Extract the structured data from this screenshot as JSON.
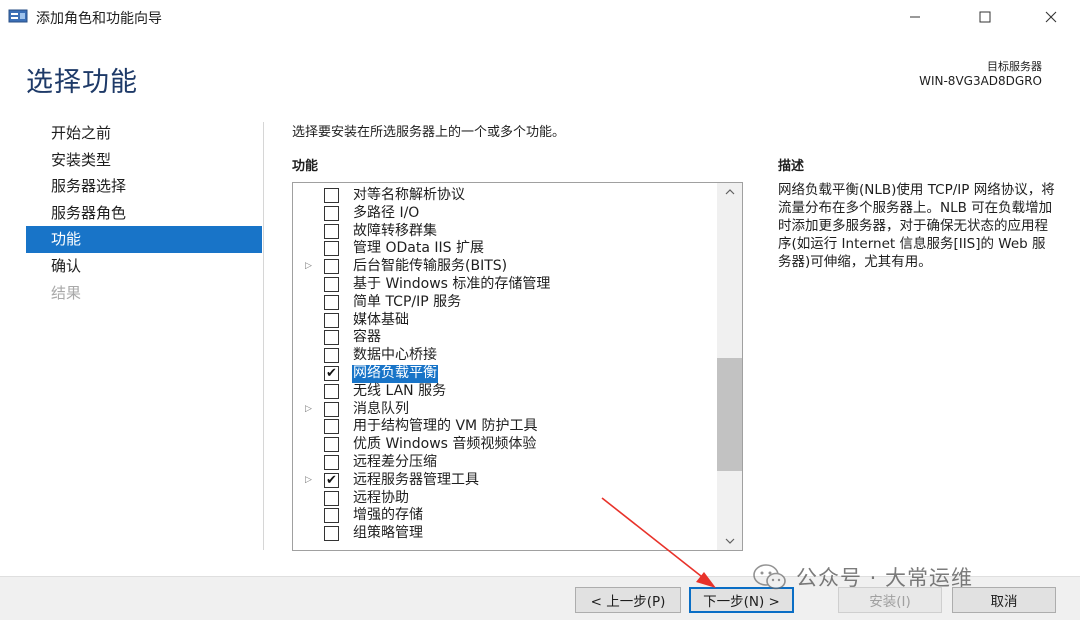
{
  "window": {
    "title": "添加角色和功能向导",
    "controls": {
      "minimize_icon": "minimize-icon",
      "maximize_icon": "maximize-icon",
      "close_icon": "close-icon"
    }
  },
  "header": {
    "page_title": "选择功能",
    "target_label": "目标服务器",
    "target_value": "WIN-8VG3AD8DGRO"
  },
  "nav": {
    "items": [
      {
        "label": "开始之前",
        "state": "normal"
      },
      {
        "label": "安装类型",
        "state": "normal"
      },
      {
        "label": "服务器选择",
        "state": "normal"
      },
      {
        "label": "服务器角色",
        "state": "normal"
      },
      {
        "label": "功能",
        "state": "active"
      },
      {
        "label": "确认",
        "state": "normal"
      },
      {
        "label": "结果",
        "state": "disabled"
      }
    ]
  },
  "main": {
    "instruction": "选择要安装在所选服务器上的一个或多个功能。",
    "features_label": "功能",
    "features": [
      {
        "label": "对等名称解析协议",
        "checked": false,
        "expandable": false,
        "selected": false
      },
      {
        "label": "多路径 I/O",
        "checked": false,
        "expandable": false,
        "selected": false
      },
      {
        "label": "故障转移群集",
        "checked": false,
        "expandable": false,
        "selected": false
      },
      {
        "label": "管理 OData IIS 扩展",
        "checked": false,
        "expandable": false,
        "selected": false
      },
      {
        "label": "后台智能传输服务(BITS)",
        "checked": false,
        "expandable": true,
        "selected": false
      },
      {
        "label": "基于 Windows 标准的存储管理",
        "checked": false,
        "expandable": false,
        "selected": false
      },
      {
        "label": "简单 TCP/IP 服务",
        "checked": false,
        "expandable": false,
        "selected": false
      },
      {
        "label": "媒体基础",
        "checked": false,
        "expandable": false,
        "selected": false
      },
      {
        "label": "容器",
        "checked": false,
        "expandable": false,
        "selected": false
      },
      {
        "label": "数据中心桥接",
        "checked": false,
        "expandable": false,
        "selected": false
      },
      {
        "label": "网络负载平衡",
        "checked": true,
        "expandable": false,
        "selected": true
      },
      {
        "label": "无线 LAN 服务",
        "checked": false,
        "expandable": false,
        "selected": false
      },
      {
        "label": "消息队列",
        "checked": false,
        "expandable": true,
        "selected": false
      },
      {
        "label": "用于结构管理的 VM 防护工具",
        "checked": false,
        "expandable": false,
        "selected": false
      },
      {
        "label": "优质 Windows 音频视频体验",
        "checked": false,
        "expandable": false,
        "selected": false
      },
      {
        "label": "远程差分压缩",
        "checked": false,
        "expandable": false,
        "selected": false
      },
      {
        "label": "远程服务器管理工具",
        "checked": true,
        "expandable": true,
        "selected": false
      },
      {
        "label": "远程协助",
        "checked": false,
        "expandable": false,
        "selected": false
      },
      {
        "label": "增强的存储",
        "checked": false,
        "expandable": false,
        "selected": false
      },
      {
        "label": "组策略管理",
        "checked": false,
        "expandable": false,
        "selected": false
      }
    ],
    "scroll_position": 0.72,
    "description_label": "描述",
    "description_text": "网络负载平衡(NLB)使用 TCP/IP 网络协议，将流量分布在多个服务器上。NLB 可在负载增加时添加更多服务器，对于确保无状态的应用程序(如运行 Internet 信息服务[IIS]的 Web 服务器)可伸缩，尤其有用。"
  },
  "footer": {
    "prev_label": "< 上一步(P)",
    "next_label": "下一步(N) >",
    "install_label": "安装(I)",
    "cancel_label": "取消"
  },
  "watermark": {
    "text": "公众号 · 大常运维",
    "icon": "wechat-icon"
  },
  "colors": {
    "accent": "#1874c8",
    "title": "#1e3a68",
    "annotation_arrow": "#e8322a"
  }
}
